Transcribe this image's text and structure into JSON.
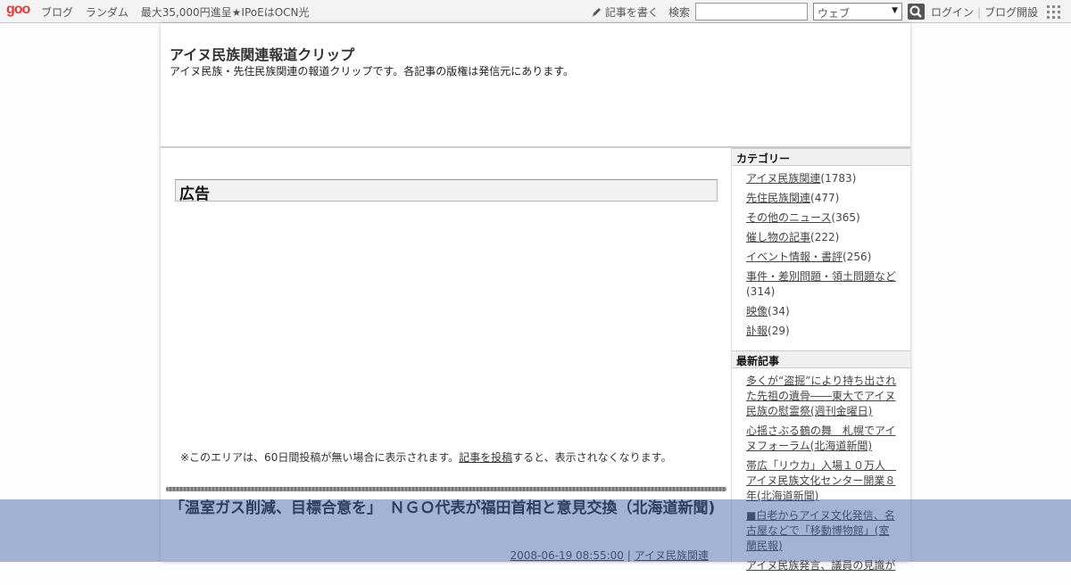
{
  "topbar": {
    "logo": "goo",
    "nav": [
      "ブログ",
      "ランダム",
      "最大35,000円進呈★IPoEはOCN光"
    ],
    "write_label": "記事を書く",
    "search_label": "検索",
    "search_placeholder": "",
    "search_scope": "ウェブ",
    "login_label": "ログイン",
    "signup_label": "ブログ開設"
  },
  "blog": {
    "title": "アイヌ民族関連報道クリップ",
    "description": "アイヌ民族・先住民族関連の報道クリップです。各記事の版権は発信元にあります。"
  },
  "ad": {
    "heading": "広告",
    "note_before": "※このエリアは、60日間投稿が無い場合に表示されます。",
    "note_link": "記事を投稿",
    "note_after": "すると、表示されなくなります。"
  },
  "post": {
    "title": "「温室ガス削減、目標合意を」　ＮＧＯ代表が福田首相と意見交換（北海道新聞)",
    "date": "2008-06-19 08:55:00",
    "separator": " | ",
    "category": "アイヌ民族関連"
  },
  "sidebar": {
    "categories_heading": "カテゴリー",
    "categories": [
      {
        "label": "アイヌ民族関連",
        "count": "(1783)"
      },
      {
        "label": "先住民族関連",
        "count": "(477)"
      },
      {
        "label": "その他のニュース",
        "count": "(365)"
      },
      {
        "label": "催し物の記事",
        "count": "(222)"
      },
      {
        "label": "イベント情報・書評",
        "count": "(256)"
      },
      {
        "label": "事件・差別問題・領土問題など",
        "count": "(314)"
      },
      {
        "label": "映像",
        "count": "(34)"
      },
      {
        "label": "訃報",
        "count": "(29)"
      }
    ],
    "recent_heading": "最新記事",
    "recent": [
      "多くが“盗掘”により持ち出された先祖の遺骨――東大でアイヌ民族の慰霊祭(週刊金曜日)",
      "心揺さぶる鶴の舞　札幌でアイヌフォーラム(北海道新聞)",
      "帯広「リウカ」入場１０万人　アイヌ民族文化センター開業８年(北海道新聞)",
      "■白老からアイヌ文化発信、名古屋などで「移動博物館」(室蘭民報)",
      "アイヌ民族発言、議員の見識が"
    ]
  },
  "colors": {
    "logo": "#e0393e",
    "overlay": "#3e62a4"
  }
}
